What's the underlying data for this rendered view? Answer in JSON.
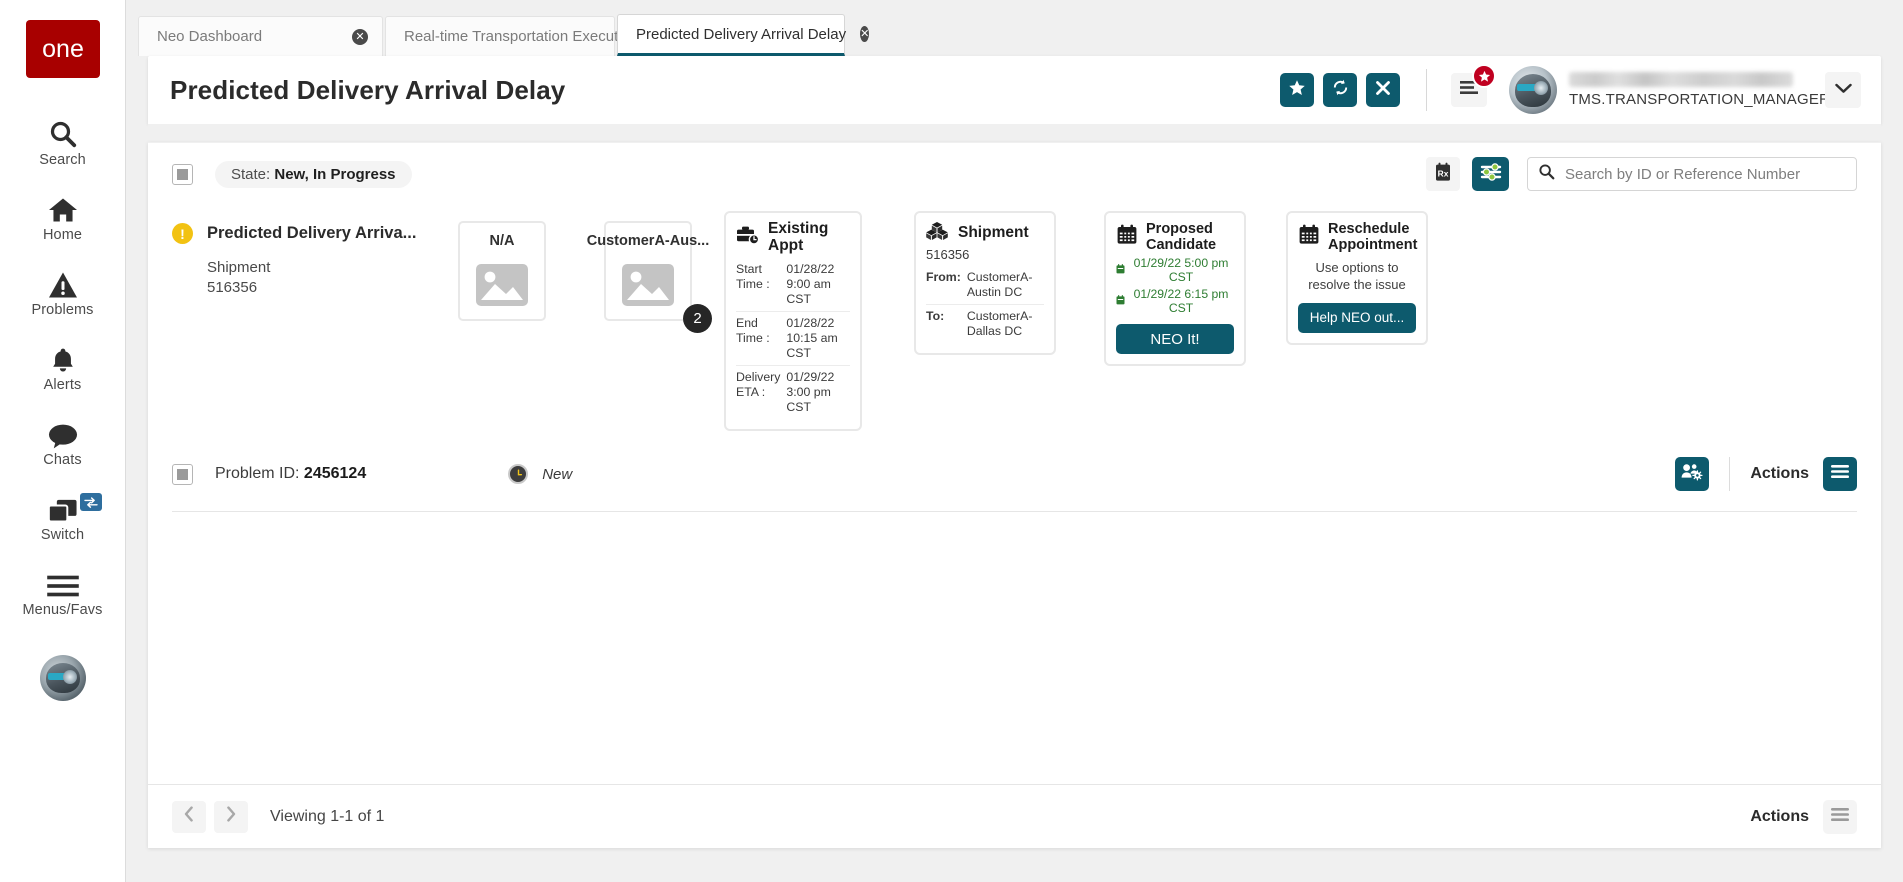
{
  "sidebar": {
    "logo_text": "one",
    "items": [
      {
        "label": "Search",
        "icon": "search-icon"
      },
      {
        "label": "Home",
        "icon": "home-icon"
      },
      {
        "label": "Problems",
        "icon": "warning-triangle-icon"
      },
      {
        "label": "Alerts",
        "icon": "bell-icon"
      },
      {
        "label": "Chats",
        "icon": "chat-bubble-icon"
      },
      {
        "label": "Switch",
        "icon": "windows-switch-icon",
        "badge_icon": "swap-arrows-icon"
      },
      {
        "label": "Menus/Favs",
        "icon": "hamburger-icon"
      }
    ]
  },
  "tabs": [
    {
      "label": "Neo Dashboard",
      "active": false,
      "close": "✕"
    },
    {
      "label": "Real-time Transportation Executi...",
      "active": false,
      "close": "✕"
    },
    {
      "label": "Predicted Delivery Arrival Delay",
      "active": true,
      "close": "✕"
    }
  ],
  "header": {
    "title": "Predicted Delivery Arrival Delay",
    "buttons": [
      {
        "name": "favorite-button",
        "icon": "star-icon"
      },
      {
        "name": "refresh-button",
        "icon": "refresh-icon"
      },
      {
        "name": "close-button",
        "icon": "close-x-icon"
      }
    ],
    "menu_icon": "hamburger-icon",
    "menu_badge_icon": "star-icon",
    "user_name": "TMS.TRANSPORTATION_MANAGER",
    "caret_icon": "chevron-down-icon"
  },
  "filter_bar": {
    "checkbox_state": "indeterminate",
    "state_label": "State:",
    "state_value": "New, In Progress",
    "export_icon": "report-export-icon",
    "filter_icon": "filter-sliders-icon",
    "search": {
      "icon": "search-icon",
      "placeholder": "Search by ID or Reference Number",
      "value": ""
    }
  },
  "problem": {
    "severity_icon": "warning-exclamation-icon",
    "title": "Predicted Delivery Arriva...",
    "entity_type": "Shipment",
    "entity_id": "516356",
    "thumbnails": [
      {
        "label": "N/A",
        "icon": "image-placeholder-icon",
        "count": null
      },
      {
        "label": "CustomerA-Aus...",
        "icon": "image-placeholder-icon",
        "count": "2"
      }
    ],
    "existing_appt": {
      "icon": "briefcase-clock-icon",
      "title": "Existing Appt",
      "rows": [
        {
          "key": "Start Time :",
          "value": "01/28/22 9:00 am CST"
        },
        {
          "key": "End Time :",
          "value": "01/28/22 10:15 am CST"
        },
        {
          "key": "Delivery ETA :",
          "value": "01/29/22 3:00 pm CST"
        }
      ]
    },
    "shipment": {
      "icon": "boxes-icon",
      "title": "Shipment",
      "id": "516356",
      "rows": [
        {
          "key": "From:",
          "value": "CustomerA-Austin DC"
        },
        {
          "key": "To:",
          "value": "CustomerA-Dallas DC"
        }
      ]
    },
    "proposed_candidate": {
      "icon": "calendar-icon",
      "title": "Proposed Candidate",
      "times": [
        {
          "icon": "calendar-small-icon",
          "text": "01/29/22 5:00 pm CST"
        },
        {
          "icon": "calendar-small-icon",
          "text": "01/29/22 6:15 pm CST"
        }
      ],
      "button_label": "NEO It!",
      "accent_color": "#2e7d32"
    },
    "reschedule": {
      "icon": "calendar-icon",
      "title": "Reschedule Appointment",
      "subtitle": "Use options to resolve the issue",
      "button_label": "Help NEO out..."
    },
    "meta": {
      "checkbox_state": "indeterminate",
      "id_label": "Problem ID:",
      "id_value": "2456124",
      "status_icon": "clock-icon",
      "status_text": "New",
      "assign_icon": "users-gear-icon",
      "actions_label": "Actions",
      "actions_icon": "hamburger-icon"
    }
  },
  "footer": {
    "prev_icon": "chevron-left-icon",
    "next_icon": "chevron-right-icon",
    "viewing_text": "Viewing 1-1 of 1",
    "actions_label": "Actions",
    "actions_icon": "hamburger-icon"
  },
  "theme": {
    "teal": "#0d5a6d",
    "brand_red": "#a80000",
    "warning_yellow": "#f2c212",
    "green": "#2e7d32",
    "badge_red": "#c00020"
  }
}
